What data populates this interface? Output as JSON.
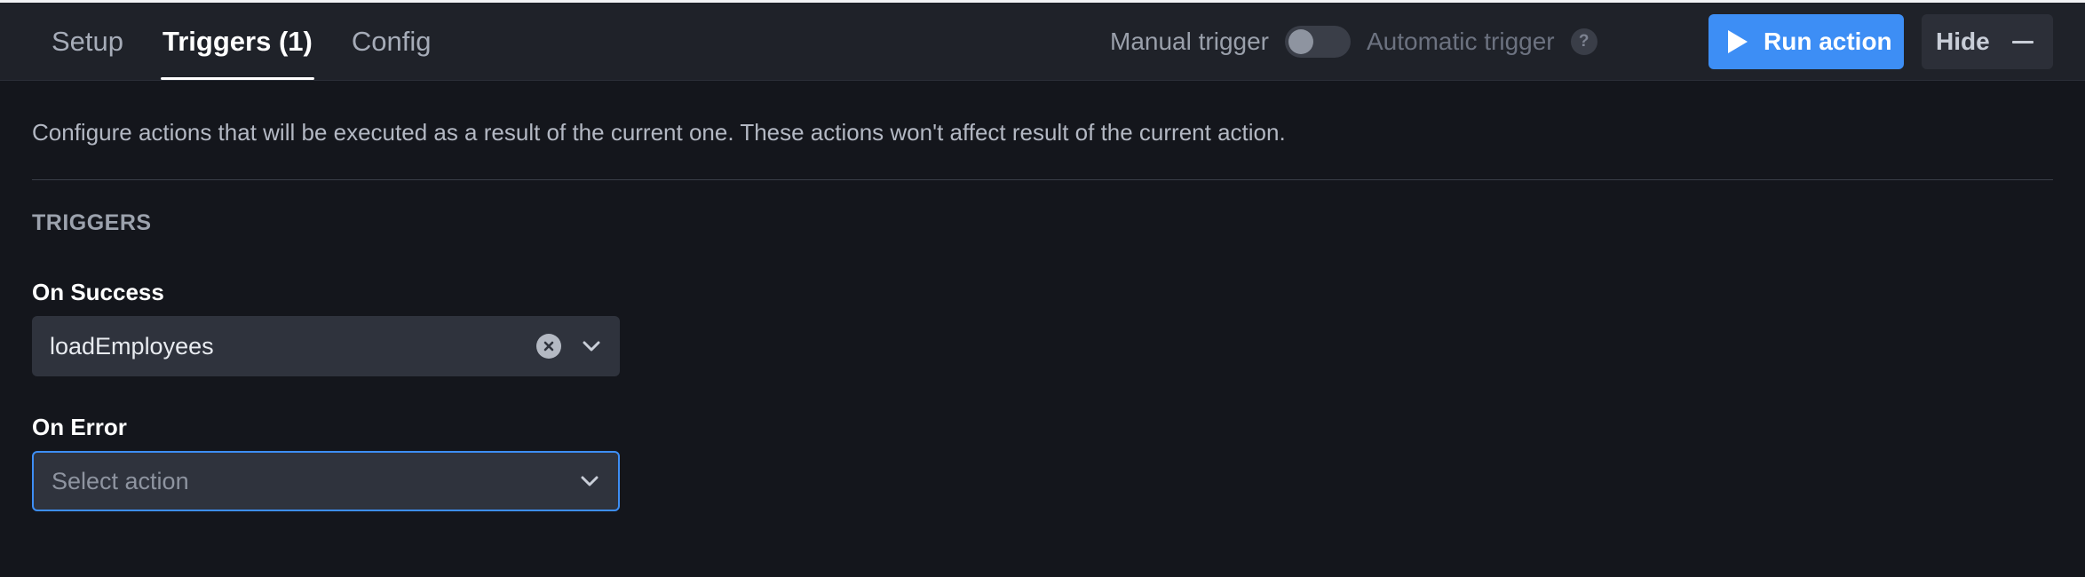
{
  "tabs": [
    {
      "label": "Setup",
      "active": false
    },
    {
      "label": "Triggers (1)",
      "active": true
    },
    {
      "label": "Config",
      "active": false
    }
  ],
  "trigger_mode": {
    "manual_label": "Manual trigger",
    "automatic_label": "Automatic trigger",
    "help_glyph": "?",
    "automatic_enabled": false
  },
  "actions": {
    "run_label": "Run action",
    "hide_label": "Hide"
  },
  "description": "Configure actions that will be executed as a result of the current one. These actions won't affect result of the current action.",
  "section_title": "TRIGGERS",
  "on_success": {
    "label": "On Success",
    "value": "loadEmployees"
  },
  "on_error": {
    "label": "On Error",
    "placeholder": "Select action"
  },
  "colors": {
    "background": "#14161c",
    "toolbar": "#1f2229",
    "accent": "#3d8ef5",
    "field": "#2f333d"
  }
}
